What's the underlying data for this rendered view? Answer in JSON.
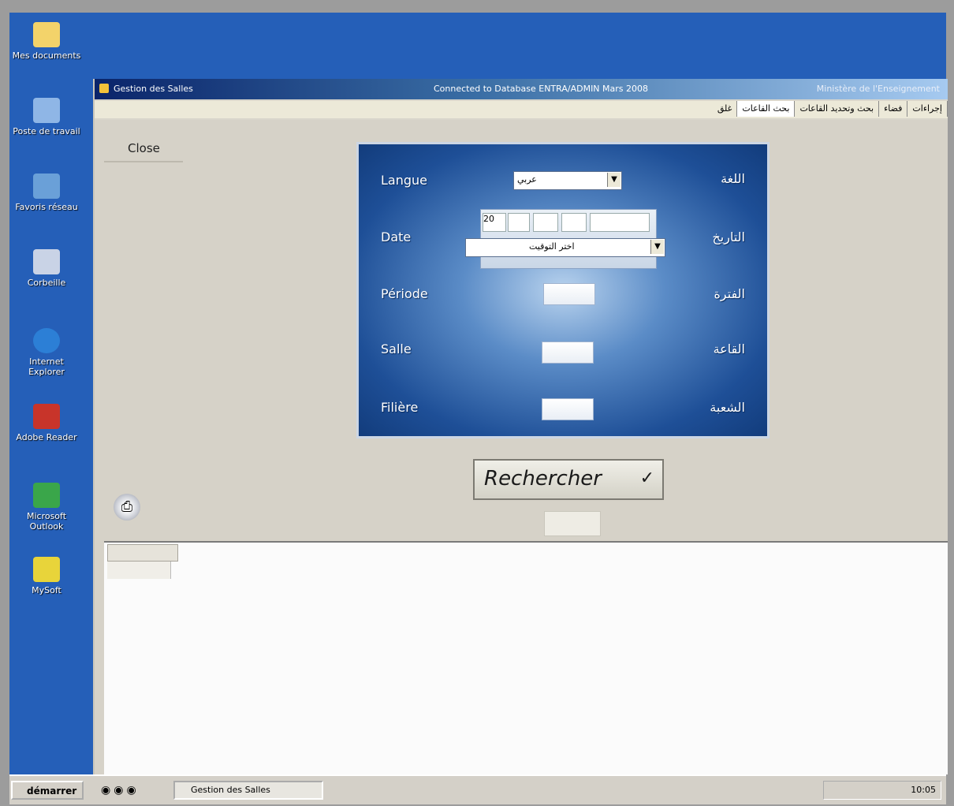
{
  "desktop": {
    "icons": [
      {
        "label": "Mes documents",
        "color": "#f3d36a"
      },
      {
        "label": "Poste de travail",
        "color": "#8fb6e6"
      },
      {
        "label": "Favoris réseau",
        "color": "#6aa0d8"
      },
      {
        "label": "Corbeille",
        "color": "#c9d3e6"
      },
      {
        "label": "Internet Explorer",
        "color": "#2c7fd6"
      },
      {
        "label": "Adobe Reader",
        "color": "#c8342a"
      },
      {
        "label": "Microsoft Outlook",
        "color": "#3aa64a"
      },
      {
        "label": "MySoft",
        "color": "#e8d43a"
      }
    ]
  },
  "window": {
    "title_left": "Gestion des Salles",
    "title_center": "Connected to Database ENTRA/ADMIN Mars 2008",
    "title_right": "Ministère de l'Enseignement",
    "tabs": [
      "إجراءات",
      "فضاء",
      "بحث وتحديد القاعات",
      "بحث القاعات",
      "غلق"
    ],
    "active_tab_index": 3
  },
  "content": {
    "close_label": "Close",
    "form": {
      "rows": [
        {
          "left": "Langue",
          "right": "اللغة"
        },
        {
          "left": "Date",
          "right": "التاريخ"
        },
        {
          "left": "Période",
          "right": "الفترة"
        },
        {
          "left": "Salle",
          "right": "القاعة"
        },
        {
          "left": "Filière",
          "right": "الشعبة"
        }
      ],
      "langue_select": "عربي",
      "date_value": "20",
      "date_select": "اختر التوقيت"
    },
    "search_button": "Rechercher",
    "search_check": "✓"
  },
  "taskbar": {
    "start_label": "démarrer",
    "task_label": "Gestion des Salles",
    "tray_time": "10:05"
  }
}
